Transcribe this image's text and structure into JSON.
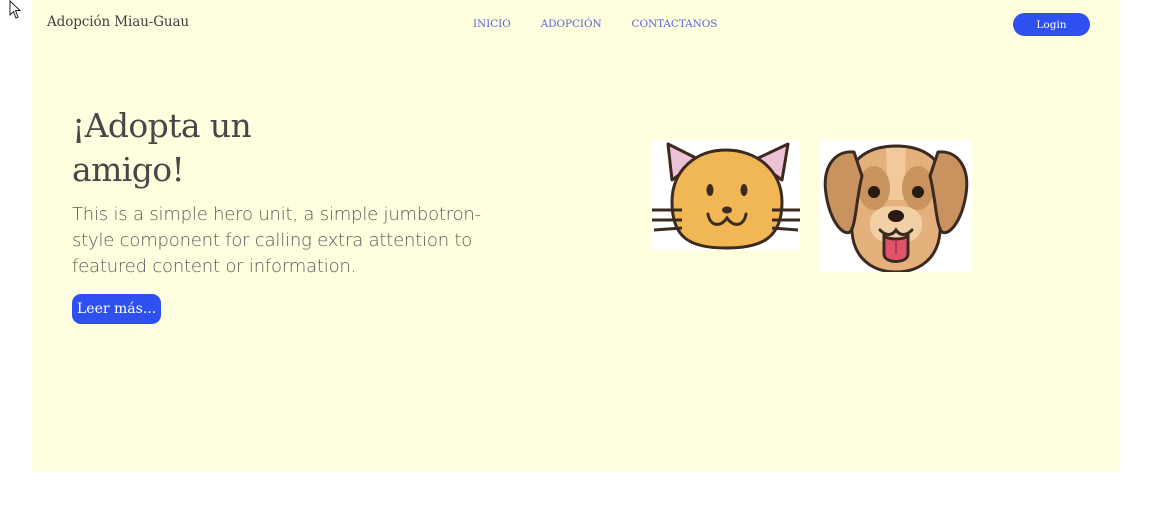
{
  "navbar": {
    "brand": "Adopción Miau-Guau",
    "links": [
      "INICIO",
      "ADOPCIÓN",
      "CONTACTANOS"
    ],
    "login_label": "Login"
  },
  "hero": {
    "title": "¡Adopta un amigo!",
    "lead": "This is a simple hero unit, a simple jumbotron-style component for calling extra attention to featured content or information.",
    "button_label": "Leer más..."
  },
  "images": {
    "cat": "cat-face-illustration",
    "dog": "dog-face-illustration"
  },
  "colors": {
    "hero_background": "#fffedf",
    "accent": "#2f50f0",
    "nav_link": "#5a64d6"
  }
}
